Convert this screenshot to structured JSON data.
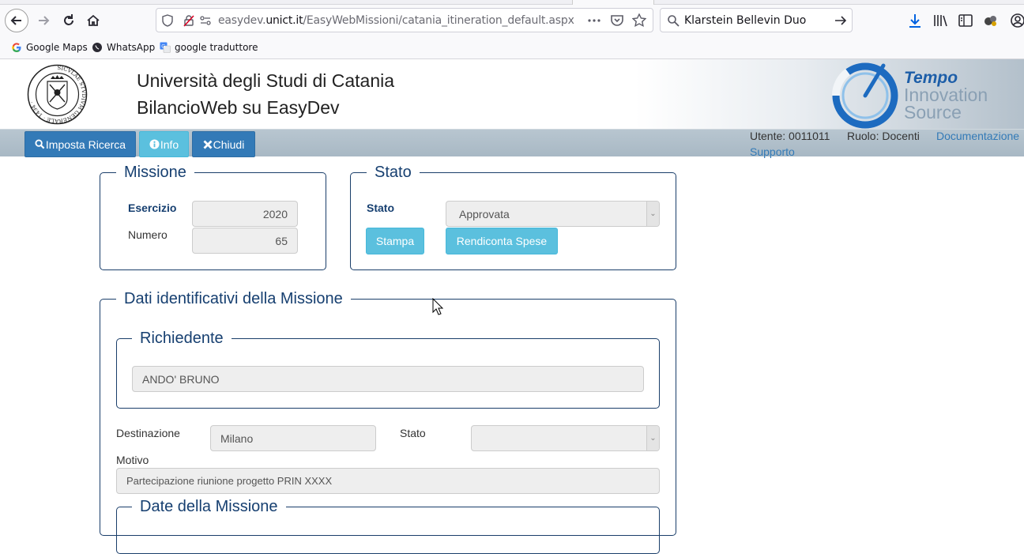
{
  "browser": {
    "url_prefix": "easydev.",
    "url_domain": "unict.it",
    "url_path": "/EasyWebMissioni/catania_itineration_default.aspx",
    "search_text": "Klarstein Bellevin Duo",
    "bookmarks": [
      {
        "label": "Google Maps",
        "icon": "google-icon"
      },
      {
        "label": "WhatsApp",
        "icon": "whatsapp-icon"
      },
      {
        "label": "google traduttore",
        "icon": "translate-icon"
      }
    ]
  },
  "header": {
    "title": "Università degli Studi di Catania",
    "subtitle": "BilancioWeb su EasyDev",
    "seal_text": "SICVLAE STVDIVM GENERALE · 1434 ·",
    "logo_line1": "Tempo",
    "logo_line2": "Innovation",
    "logo_line3": "Source"
  },
  "menu": {
    "search_label": "Imposta Ricerca",
    "info_label": "Info",
    "close_label": "Chiudi",
    "user": "Utente: 0011011",
    "role": "Ruolo: Docenti",
    "docs": "Documentazione",
    "support": "Supporto"
  },
  "missione": {
    "legend": "Missione",
    "esercizio_label": "Esercizio",
    "esercizio_value": "2020",
    "numero_label": "Numero",
    "numero_value": "65"
  },
  "stato": {
    "legend": "Stato",
    "stato_label": "Stato",
    "stato_value": "Approvata",
    "print_label": "Stampa",
    "expenses_label": "Rendiconta Spese"
  },
  "dati": {
    "legend": "Dati identificativi della Missione",
    "richiedente_legend": "Richiedente",
    "richiedente_value": "ANDO' BRUNO",
    "destinazione_label": "Destinazione",
    "destinazione_value": "Milano",
    "stato_label": "Stato",
    "stato_value": "",
    "motivo_label": "Motivo",
    "motivo_value": "Partecipazione riunione progetto PRIN XXXX",
    "date_legend": "Date della Missione"
  },
  "colors": {
    "primary": "#337ab7",
    "info": "#5bc0de",
    "legend": "#163f70"
  }
}
